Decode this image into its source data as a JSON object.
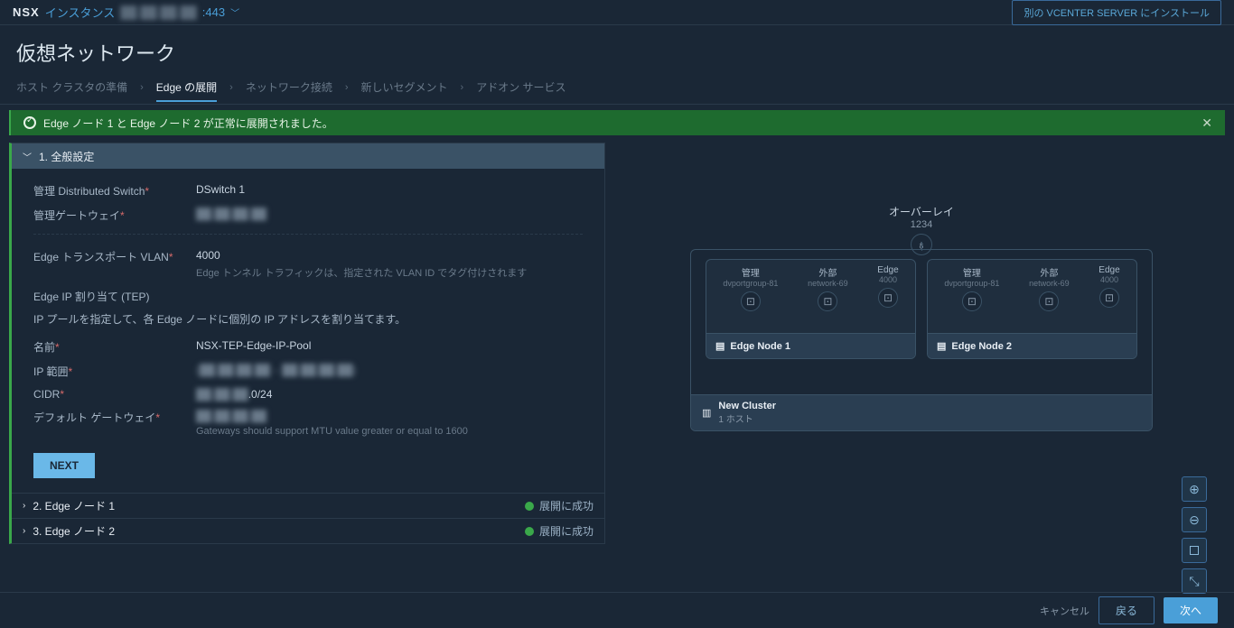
{
  "header": {
    "nsx": "NSX",
    "instance_label": "インスタンス",
    "instance_val": "██.██.██.██",
    "instance_port": ":443",
    "install_btn": "別の VCENTER SERVER にインストール"
  },
  "page_title": "仮想ネットワーク",
  "breadcrumbs": {
    "hosts": "ホスト クラスタの準備",
    "edge": "Edge の展開",
    "network": "ネットワーク接続",
    "segment": "新しいセグメント",
    "addon": "アドオン サービス"
  },
  "banner": {
    "text": "Edge ノード 1 と Edge ノード 2 が正常に展開されました。"
  },
  "accordion": {
    "general": {
      "title": "1. 全般設定",
      "dswitch_lbl": "管理 Distributed Switch",
      "dswitch_val": "DSwitch 1",
      "mgmt_gw_lbl": "管理ゲートウェイ",
      "mgmt_gw_val": "██.██.██.██",
      "vlan_lbl": "Edge トランスポート VLAN",
      "vlan_val": "4000",
      "vlan_help": "Edge トンネル トラフィックは、指定された VLAN ID でタグ付けされます",
      "tep_head": "Edge IP 割り当て (TEP)",
      "tep_desc": "IP プールを指定して、各 Edge ノードに個別の IP アドレスを割り当てます。",
      "name_lbl": "名前",
      "name_val": "NSX-TEP-Edge-IP-Pool",
      "range_lbl": "IP 範囲",
      "range_val": "(██.██.██.██ – ██.██.██.██)",
      "cidr_lbl": "CIDR",
      "cidr_val": "██.██.██.0/24",
      "defgw_lbl": "デフォルト ゲートウェイ",
      "defgw_val": "██.██.██.██",
      "defgw_help": "Gateways should support MTU value greater or equal to 1600",
      "next_btn": "NEXT"
    },
    "edge1": {
      "title": "2. Edge ノード 1",
      "status": "展開に成功"
    },
    "edge2": {
      "title": "3. Edge ノード 2",
      "status": "展開に成功"
    }
  },
  "diagram": {
    "overlay": "オーバーレイ",
    "overlay_num": "1234",
    "ports": {
      "mgmt": "管理",
      "mgmt_sub": "dvportgroup-81",
      "ext": "外部",
      "ext_sub": "network-69",
      "edge": "Edge",
      "edge_sub": "4000"
    },
    "node1": "Edge Node 1",
    "node2": "Edge Node 2",
    "cluster": "New Cluster",
    "cluster_sub": "1 ホスト"
  },
  "footer": {
    "cancel": "キャンセル",
    "back": "戻る",
    "next": "次へ"
  }
}
